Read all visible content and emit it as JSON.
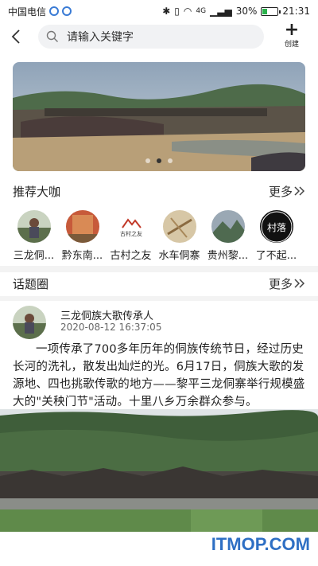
{
  "status_bar": {
    "carrier": "中国电信",
    "signal_text": "4G",
    "battery": "30%",
    "time": "21:31"
  },
  "header": {
    "search_placeholder": "请输入关键字",
    "create_label": "创建"
  },
  "banner": {
    "dot_count": 3,
    "active_dot": 1
  },
  "experts_section": {
    "title": "推荐大咖",
    "more_label": "更多",
    "items": [
      {
        "name": "三龙侗..."
      },
      {
        "name": "黔东南..."
      },
      {
        "name": "古村之友"
      },
      {
        "name": "水车侗寨"
      },
      {
        "name": "贵州黎..."
      },
      {
        "name": "了不起..."
      }
    ],
    "logo_text": "古村之友",
    "logo_badge": "村落"
  },
  "topics_section": {
    "title": "话题圈",
    "more_label": "更多"
  },
  "post": {
    "author": "三龙侗族大歌传承人",
    "time": "2020-08-12 16:37:05",
    "content": "一项传承了700多年历年的侗族传统节日，经过历史长河的洗礼，散发出灿烂的光。6月17日，侗族大歌的发源地、四也挑歌传歌的地方——黎平三龙侗寨举行规模盛大的\"关秧门节\"活动。十里八乡万余群众参与。"
  },
  "watermark": "ITMOP.COM",
  "colors": {
    "accent_blue": "#2e6fc4",
    "battery_green": "#2bb24c",
    "search_bg": "#f1f2f4",
    "divider": "#f3f3f3"
  }
}
